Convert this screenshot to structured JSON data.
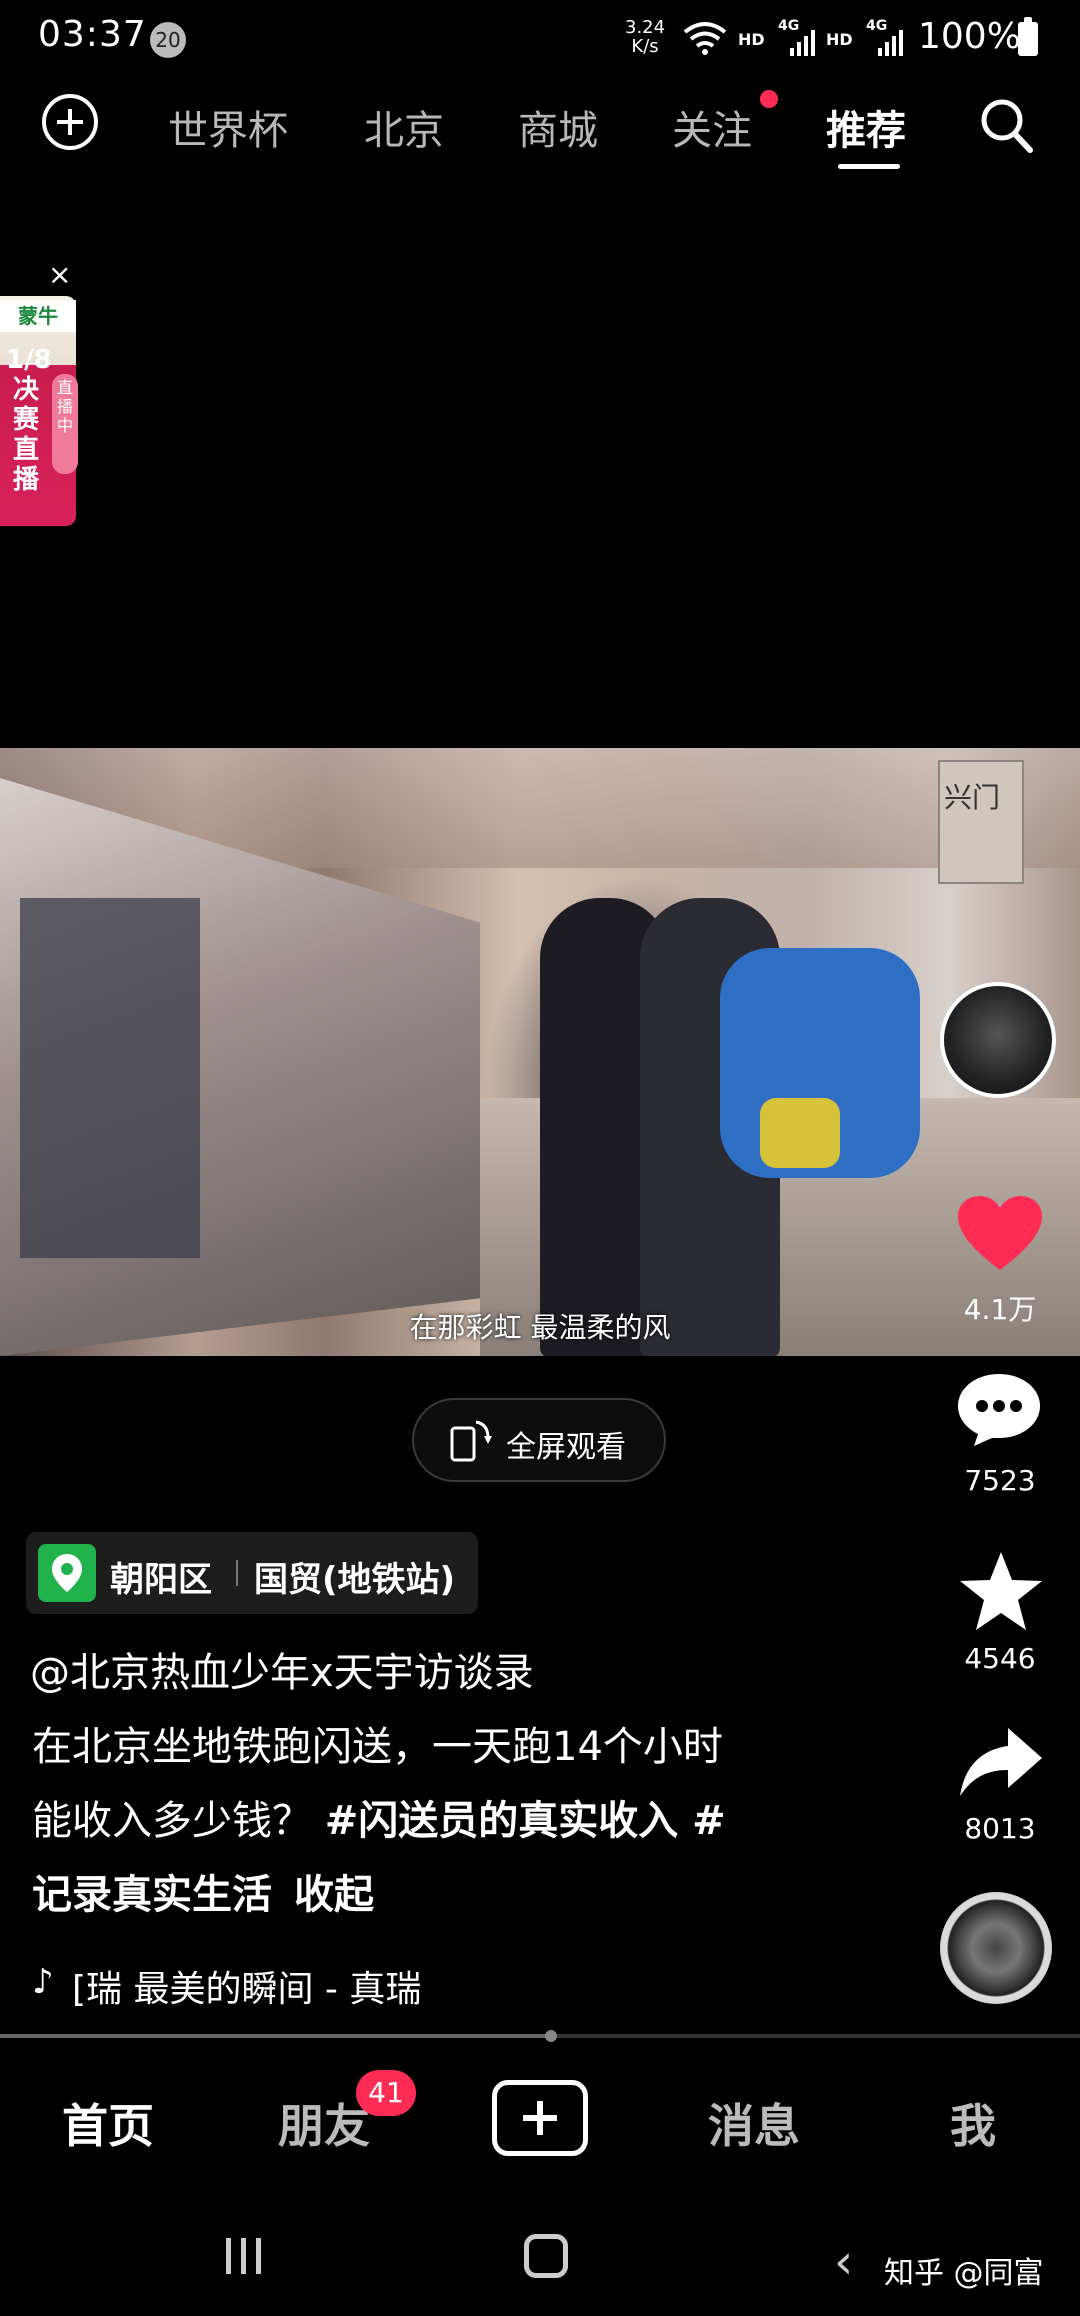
{
  "status_bar": {
    "time": "03:37",
    "notification_count": "20",
    "net_speed_value": "3.24",
    "net_speed_unit": "K/s",
    "signal1_label": "HD",
    "signal1_type": "4G",
    "signal2_label": "HD",
    "signal2_type": "4G",
    "battery": "100%"
  },
  "top_nav": {
    "tabs": [
      {
        "label": "世界杯"
      },
      {
        "label": "北京"
      },
      {
        "label": "商城"
      },
      {
        "label": "关注"
      },
      {
        "label": "推荐"
      }
    ],
    "active_tab": "推荐"
  },
  "ad": {
    "close": "×",
    "brand": "蒙牛",
    "title": "1/8决赛直播",
    "live": "直播中"
  },
  "video": {
    "caption": "在那彩虹 最温柔的风",
    "sign_text": "兴门",
    "fullscreen_label": "全屏观看"
  },
  "actions": {
    "likes": "4.1万",
    "comments": "7523",
    "favorites": "4546",
    "shares": "8013"
  },
  "location": {
    "district": "朝阳区",
    "place": "国贸(地铁站)"
  },
  "post": {
    "author": "@北京热血少年x天宇访谈录",
    "line1": "在北京坐地铁跑闪送，一天跑14个小时",
    "line2_text": "能收入多少钱？ ",
    "hashtag1": "#闪送员的真实收入 #",
    "hashtag2": "记录真实生活",
    "collapse": "收起"
  },
  "music": {
    "title": "[瑞    最美的瞬间 - 真瑞"
  },
  "bottom_nav": {
    "items": [
      {
        "label": "首页"
      },
      {
        "label": "朋友"
      },
      {
        "label": "消息"
      },
      {
        "label": "我"
      }
    ],
    "friends_badge": "41"
  },
  "watermark": "知乎 @同富",
  "colors": {
    "accent_red": "#fe2c55",
    "location_green": "#22b24c"
  },
  "progress": {
    "fraction": 0.51
  }
}
